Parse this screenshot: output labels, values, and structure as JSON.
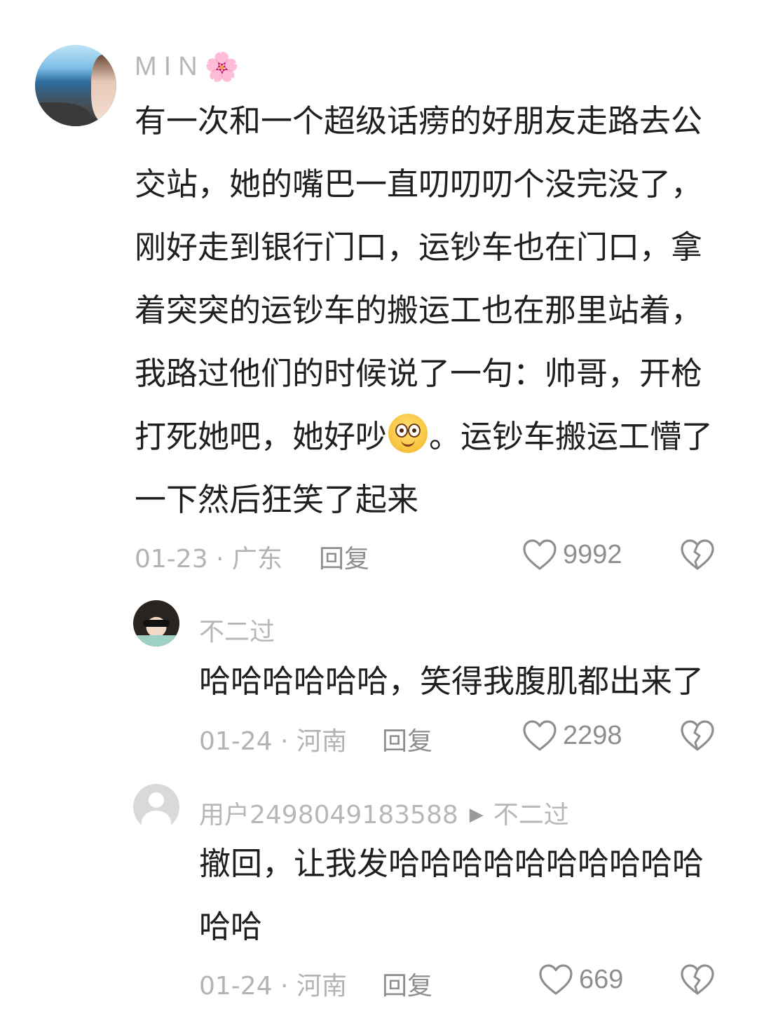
{
  "colors": {
    "username": "#b7b7b7",
    "body_text": "#1f1f1f",
    "meta": "#b3b3b3",
    "action": "#8e8e8e"
  },
  "main_comment": {
    "username": "MIN",
    "username_decoration": "🌸",
    "content_before_emoji": "有一次和一个超级话痨的好朋友走路去公交站，她的嘴巴一直叨叨叨个没完没了，刚好走到银行门口，运钞车也在门口，拿着突突的运钞车的搬运工也在那里站着，我路过他们的时候说了一句：帅哥，开枪打死她吧，她好吵",
    "content_emoji": "smiling-face-wide-eyes",
    "content_after_emoji": "。运钞车搬运工懵了一下然后狂笑了起来",
    "date_location": "01-23 · 广东",
    "reply_label": "回复",
    "like_count": "9992",
    "like_icon": "heart-outline-icon",
    "dislike_icon": "broken-heart-icon"
  },
  "replies": [
    {
      "username": "不二过",
      "content": "哈哈哈哈哈哈，笑得我腹肌都出来了",
      "date_location": "01-24 · 河南",
      "reply_label": "回复",
      "like_count": "2298"
    },
    {
      "username": "用户2498049183588",
      "reply_arrow": "▶",
      "reply_to": "不二过",
      "content": "撤回，让我发哈哈哈哈哈哈哈哈哈哈哈哈",
      "date_location": "01-24 · 河南",
      "reply_label": "回复",
      "like_count": "669"
    }
  ]
}
